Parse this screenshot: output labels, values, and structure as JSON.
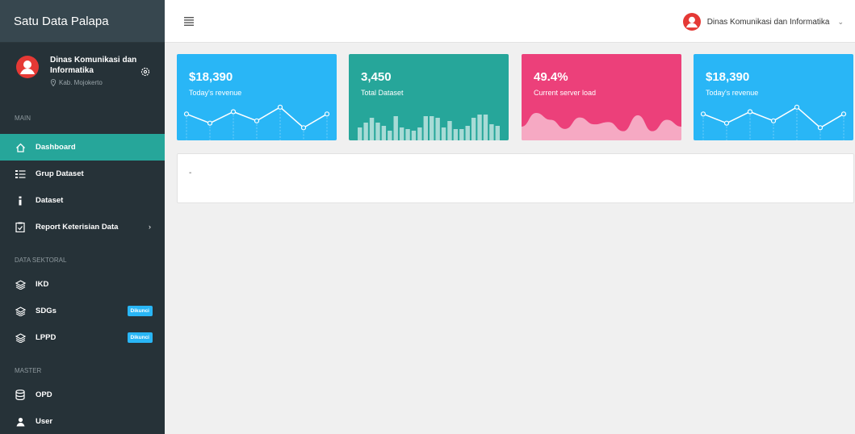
{
  "brand": "Satu Data Palapa",
  "profile": {
    "name": "Dinas Komunikasi dan Informatika",
    "location": "Kab. Mojokerto"
  },
  "sections": {
    "main": "MAIN",
    "data_sektoral": "DATA SEKTORAL",
    "master": "MASTER"
  },
  "nav": {
    "dashboard": "Dashboard",
    "grup_dataset": "Grup Dataset",
    "dataset": "Dataset",
    "report": "Report Keterisian Data",
    "ikd": "IKD",
    "sdgs": "SDGs",
    "lppd": "LPPD",
    "opd": "OPD",
    "user": "User"
  },
  "badges": {
    "locked": "Dikunci"
  },
  "header": {
    "user_name": "Dinas Komunikasi dan Informatika"
  },
  "cards": [
    {
      "value": "$18,390",
      "label": "Today's revenue",
      "color": "#29b6f6",
      "spark": "line",
      "points": [
        40,
        20,
        45,
        25,
        55,
        10,
        40
      ]
    },
    {
      "value": "3,450",
      "label": "Total Dataset",
      "color": "#26a69a",
      "spark": "bar",
      "points": [
        40,
        55,
        70,
        55,
        45,
        30,
        75,
        40,
        35,
        30,
        40,
        75,
        75,
        70,
        40,
        60,
        35,
        35,
        45,
        70,
        80,
        80,
        50,
        45
      ]
    },
    {
      "value": "49.4%",
      "label": "Current server load",
      "color": "#ec407a",
      "spark": "area",
      "points": [
        30,
        60,
        45,
        25,
        50,
        35,
        40,
        20,
        55,
        20,
        45,
        30
      ]
    },
    {
      "value": "$18,390",
      "label": "Today's revenue",
      "color": "#29b6f6",
      "spark": "line",
      "points": [
        40,
        20,
        45,
        25,
        55,
        10,
        40
      ]
    }
  ],
  "panel": {
    "text": "-"
  }
}
